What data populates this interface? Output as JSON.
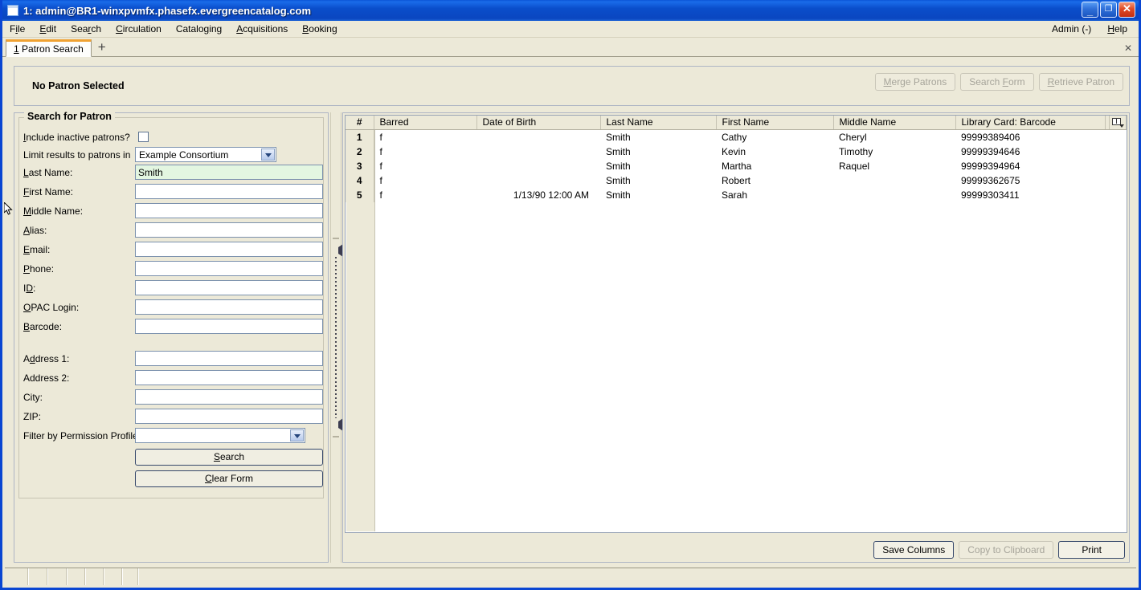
{
  "window": {
    "title": "1: admin@BR1-winxpvmfx.phasefx.evergreencatalog.com",
    "icon": "window-icon",
    "minimize": "_",
    "maximize": "❐",
    "close": "✕"
  },
  "menubar": {
    "items": [
      {
        "pre": "F",
        "acc": "i",
        "post": "le"
      },
      {
        "pre": "",
        "acc": "E",
        "post": "dit"
      },
      {
        "pre": "Sea",
        "acc": "r",
        "post": "ch"
      },
      {
        "pre": "",
        "acc": "C",
        "post": "irculation"
      },
      {
        "pre": "Catalo",
        "acc": "g",
        "post": "ing"
      },
      {
        "pre": "",
        "acc": "A",
        "post": "cquisitions"
      },
      {
        "pre": "",
        "acc": "B",
        "post": "ooking"
      }
    ],
    "right": [
      {
        "pre": "Admin (-)",
        "acc": "",
        "post": ""
      },
      {
        "pre": "",
        "acc": "H",
        "post": "elp"
      }
    ]
  },
  "tabs": {
    "items": [
      {
        "num": "1",
        "label": "Patron Search"
      }
    ],
    "add_label": "+",
    "close_label": "✕"
  },
  "banner": {
    "status": "No Patron Selected",
    "buttons": [
      {
        "pre": "",
        "acc": "M",
        "post": "erge Patrons",
        "enabled": false
      },
      {
        "pre": "Search ",
        "acc": "F",
        "post": "orm",
        "enabled": false
      },
      {
        "pre": "",
        "acc": "R",
        "post": "etrieve Patron",
        "enabled": false
      }
    ]
  },
  "search_form": {
    "legend": "Search for Patron",
    "fields": [
      {
        "label_pre": "",
        "label_acc": "I",
        "label_post": "nclude inactive patrons?",
        "type": "checkbox",
        "checked": false,
        "name": "include-inactive-patrons"
      },
      {
        "label_pre": "Limit results to patrons in",
        "label_acc": "",
        "label_post": "",
        "type": "select",
        "value": "Example Consortium",
        "name": "limit-results-org"
      },
      {
        "label_pre": "",
        "label_acc": "L",
        "label_post": "ast Name:",
        "type": "text",
        "value": "Smith",
        "focused": true,
        "name": "last-name"
      },
      {
        "label_pre": "",
        "label_acc": "F",
        "label_post": "irst Name:",
        "type": "text",
        "value": "",
        "name": "first-name"
      },
      {
        "label_pre": "",
        "label_acc": "M",
        "label_post": "iddle Name:",
        "type": "text",
        "value": "",
        "name": "middle-name"
      },
      {
        "label_pre": "",
        "label_acc": "A",
        "label_post": "lias:",
        "type": "text",
        "value": "",
        "name": "alias"
      },
      {
        "label_pre": "",
        "label_acc": "E",
        "label_post": "mail:",
        "type": "text",
        "value": "",
        "name": "email"
      },
      {
        "label_pre": "",
        "label_acc": "P",
        "label_post": "hone:",
        "type": "text",
        "value": "",
        "name": "phone"
      },
      {
        "label_pre": "I",
        "label_acc": "D",
        "label_post": ":",
        "type": "text",
        "value": "",
        "name": "id"
      },
      {
        "label_pre": "",
        "label_acc": "O",
        "label_post": "PAC Login:",
        "type": "text",
        "value": "",
        "name": "opac-login"
      },
      {
        "label_pre": "",
        "label_acc": "B",
        "label_post": "arcode:",
        "type": "text",
        "value": "",
        "name": "barcode"
      },
      {
        "label_pre": "A",
        "label_acc": "d",
        "label_post": "dress 1:",
        "type": "text",
        "value": "",
        "name": "address-1"
      },
      {
        "label_pre": "Address 2:",
        "label_acc": "",
        "label_post": "",
        "type": "text",
        "value": "",
        "name": "address-2"
      },
      {
        "label_pre": "City:",
        "label_acc": "",
        "label_post": "",
        "type": "text",
        "value": "",
        "name": "city"
      },
      {
        "label_pre": "ZIP:",
        "label_acc": "",
        "label_post": "",
        "type": "text",
        "value": "",
        "name": "zip"
      },
      {
        "label_pre": "Filter by Permission Profile:",
        "label_acc": "",
        "label_post": "",
        "type": "select",
        "value": "",
        "name": "permission-profile"
      }
    ],
    "buttons": [
      {
        "pre": "",
        "acc": "S",
        "post": "earch",
        "name": "search-button"
      },
      {
        "pre": "",
        "acc": "C",
        "post": "lear Form",
        "name": "clear-form-button"
      }
    ]
  },
  "results": {
    "columns": [
      "#",
      "Barred",
      "Date of Birth",
      "Last Name",
      "First Name",
      "Middle Name",
      "Library Card: Barcode"
    ],
    "column_picker_icon": "column-picker-icon",
    "rows": [
      {
        "num": "1",
        "barred": "f",
        "dob": "",
        "last": "Smith",
        "first": "Cathy",
        "middle": "Cheryl",
        "barcode": "99999389406"
      },
      {
        "num": "2",
        "barred": "f",
        "dob": "",
        "last": "Smith",
        "first": "Kevin",
        "middle": "Timothy",
        "barcode": "99999394646"
      },
      {
        "num": "3",
        "barred": "f",
        "dob": "",
        "last": "Smith",
        "first": "Martha",
        "middle": "Raquel",
        "barcode": "99999394964"
      },
      {
        "num": "4",
        "barred": "f",
        "dob": "",
        "last": "Smith",
        "first": "Robert",
        "middle": "",
        "barcode": "99999362675"
      },
      {
        "num": "5",
        "barred": "f",
        "dob": "1/13/90 12:00 AM",
        "last": "Smith",
        "first": "Sarah",
        "middle": "",
        "barcode": "99999303411"
      }
    ],
    "buttons": [
      {
        "label": "Save Columns",
        "enabled": true,
        "name": "save-columns-button"
      },
      {
        "label": "Copy to Clipboard",
        "enabled": false,
        "name": "copy-to-clipboard-button"
      },
      {
        "label": "Print",
        "enabled": true,
        "name": "print-button"
      }
    ]
  },
  "colors": {
    "chrome": "#ece9d8",
    "title_blue": "#0a46c0",
    "tab_accent": "#f0a232",
    "field_focus": "#e3f6e1"
  }
}
